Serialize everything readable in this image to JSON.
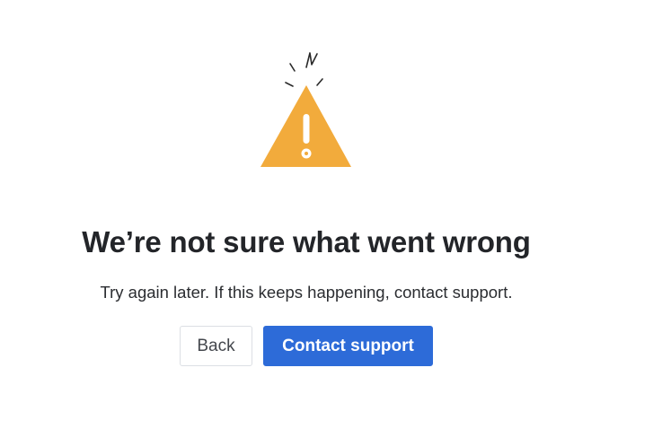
{
  "error": {
    "heading": "We’re not sure what went wrong",
    "message": "Try again later. If this keeps happening, contact support.",
    "illustration_icon": "warning-triangle-icon",
    "accent_color": "#F2AB3C"
  },
  "actions": {
    "back_label": "Back",
    "contact_label": "Contact support",
    "primary_color": "#2D6BD8"
  }
}
